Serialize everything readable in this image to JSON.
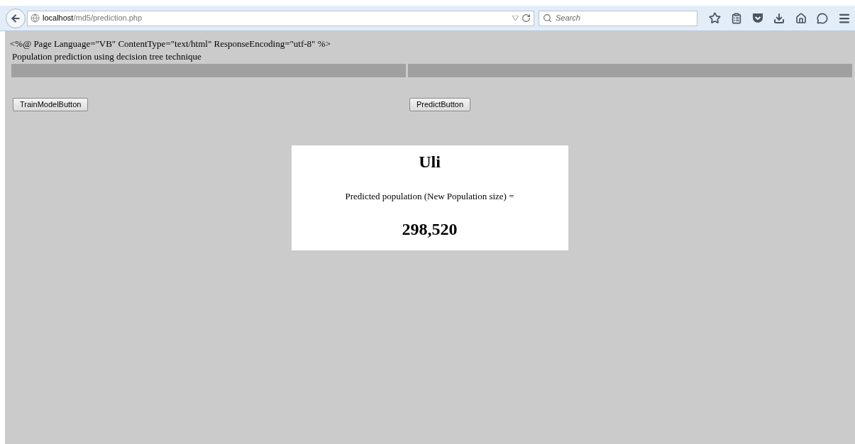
{
  "browser": {
    "url_host": "localhost",
    "url_path": "/md5/prediction.php",
    "search_placeholder": "Search"
  },
  "page": {
    "directive": "<%@ Page Language=\"VB\" ContentType=\"text/html\" ResponseEncoding=\"utf-8\" %>",
    "heading": "Population prediction using decision tree technique",
    "buttons": [
      "TrainModelButton",
      "PredictButton"
    ],
    "result": {
      "title": "Uli",
      "label": "Predicted population (New Population size) =",
      "value": "298,520"
    }
  }
}
